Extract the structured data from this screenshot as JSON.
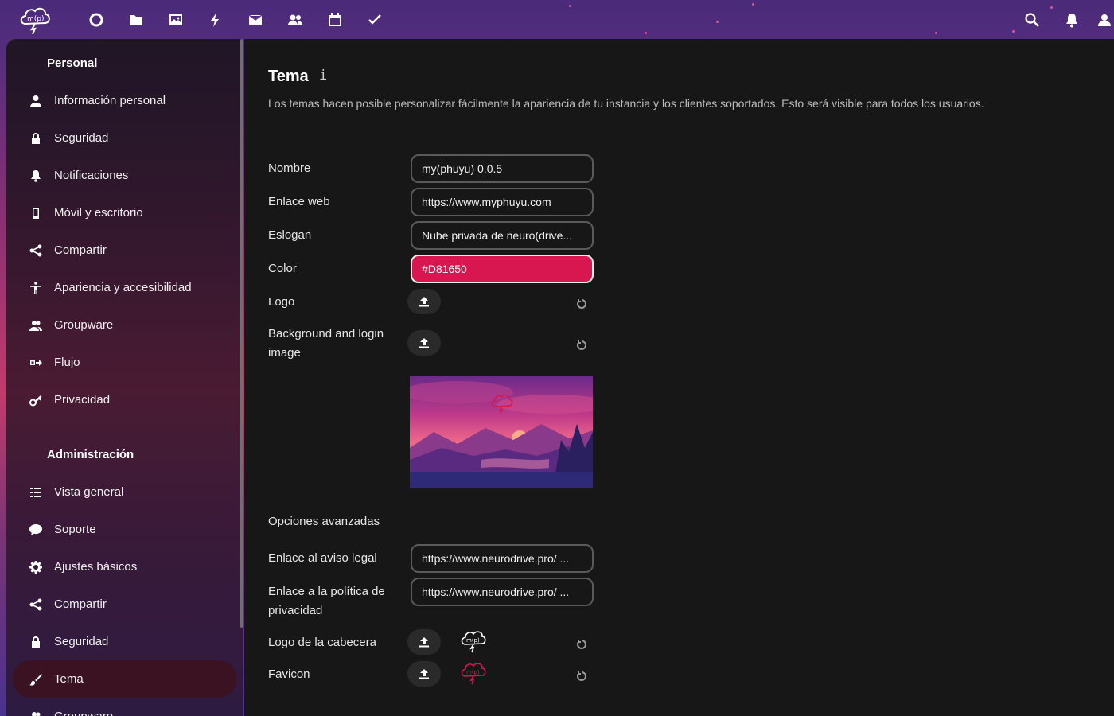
{
  "header": {
    "apps": [
      {
        "name": "dashboard-icon"
      },
      {
        "name": "files-icon"
      },
      {
        "name": "photos-icon"
      },
      {
        "name": "activity-icon"
      },
      {
        "name": "mail-icon"
      },
      {
        "name": "contacts-icon"
      },
      {
        "name": "calendar-icon"
      },
      {
        "name": "tasks-icon"
      }
    ],
    "right": [
      {
        "name": "search-icon"
      },
      {
        "name": "notifications-icon"
      },
      {
        "name": "contacts-menu-icon"
      }
    ]
  },
  "sidebar": {
    "personal_title": "Personal",
    "personal_items": [
      {
        "label": "Información personal",
        "icon": "user-icon"
      },
      {
        "label": "Seguridad",
        "icon": "lock-icon"
      },
      {
        "label": "Notificaciones",
        "icon": "bell-icon"
      },
      {
        "label": "Móvil y escritorio",
        "icon": "phone-icon"
      },
      {
        "label": "Compartir",
        "icon": "share-icon"
      },
      {
        "label": "Apariencia y accesibilidad",
        "icon": "accessibility-icon"
      },
      {
        "label": "Groupware",
        "icon": "group-icon"
      },
      {
        "label": "Flujo",
        "icon": "flow-icon"
      },
      {
        "label": "Privacidad",
        "icon": "key-icon"
      }
    ],
    "admin_title": "Administración",
    "admin_items": [
      {
        "label": "Vista general",
        "icon": "list-icon"
      },
      {
        "label": "Soporte",
        "icon": "chat-bubble-icon"
      },
      {
        "label": "Ajustes básicos",
        "icon": "gear-icon"
      },
      {
        "label": "Compartir",
        "icon": "share-icon"
      },
      {
        "label": "Seguridad",
        "icon": "lock-icon"
      },
      {
        "label": "Tema",
        "icon": "paintbrush-icon"
      },
      {
        "label": "Groupware",
        "icon": "group-icon"
      }
    ]
  },
  "main": {
    "title": "Tema",
    "description": "Los temas hacen posible personalizar fácilmente la apariencia de tu instancia y los clientes soportados. Esto será visible para todos los usuarios.",
    "fields": {
      "name_label": "Nombre",
      "name_value": "my(phuyu) 0.0.5",
      "url_label": "Enlace web",
      "url_value": "https://www.myphuyu.com",
      "slogan_label": "Eslogan",
      "slogan_value": "Nube privada de neuro(drive...",
      "color_label": "Color",
      "color_value": "#D81650",
      "logo_label": "Logo",
      "background_label": "Background and login image"
    },
    "advanced_title": "Opciones avanzadas",
    "advanced": {
      "legal_label": "Enlace al aviso legal",
      "legal_value": "https://www.neurodrive.pro/ ...",
      "privacy_label": "Enlace a la política de privacidad",
      "privacy_value": "https://www.neurodrive.pro/ ...",
      "header_logo_label": "Logo de la cabecera",
      "favicon_label": "Favicon"
    },
    "accent_color": "#D81650"
  }
}
